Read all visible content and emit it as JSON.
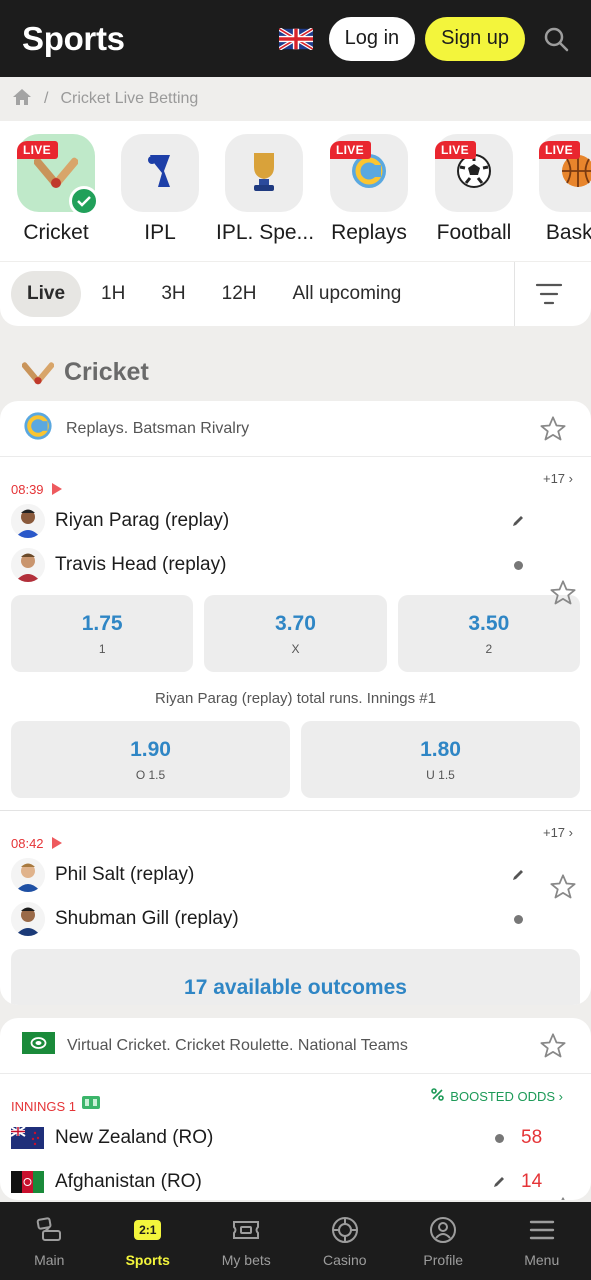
{
  "header": {
    "title": "Sports",
    "login": "Log in",
    "signup": "Sign up"
  },
  "breadcrumb": {
    "current": "Cricket Live Betting"
  },
  "categories": [
    {
      "label": "Cricket",
      "live": true,
      "active": true
    },
    {
      "label": "IPL",
      "live": false
    },
    {
      "label": "IPL. Spe...",
      "live": false
    },
    {
      "label": "Replays",
      "live": true
    },
    {
      "label": "Football",
      "live": true
    },
    {
      "label": "Basket",
      "live": true
    }
  ],
  "live_badge": "LIVE",
  "filters": [
    "Live",
    "1H",
    "3H",
    "12H",
    "All upcoming"
  ],
  "section": {
    "title": "Cricket"
  },
  "league1": {
    "name": "Replays. Batsman Rivalry",
    "match1": {
      "time": "08:39",
      "more": "+17",
      "team1": "Riyan Parag (replay)",
      "team2": "Travis Head (replay)",
      "odds": [
        {
          "v": "1.75",
          "k": "1"
        },
        {
          "v": "3.70",
          "k": "X"
        },
        {
          "v": "3.50",
          "k": "2"
        }
      ],
      "market": "Riyan Parag (replay) total runs. Innings #1",
      "totals": [
        {
          "v": "1.90",
          "k": "O 1.5"
        },
        {
          "v": "1.80",
          "k": "U 1.5"
        }
      ]
    },
    "match2": {
      "time": "08:42",
      "more": "+17",
      "team1": "Phil Salt (replay)",
      "team2": "Shubman Gill (replay)",
      "outcomes": "17 available outcomes"
    }
  },
  "league2": {
    "name": "Virtual Cricket. Cricket Roulette. National Teams",
    "match": {
      "innings": "INNINGS 1",
      "boost": "BOOSTED ODDS",
      "team1": "New Zealand (RO)",
      "score1": "58",
      "team2": "Afghanistan (RO)",
      "score2": "14"
    }
  },
  "nav": [
    {
      "label": "Main"
    },
    {
      "label": "Sports",
      "badge": "2:1"
    },
    {
      "label": "My bets"
    },
    {
      "label": "Casino"
    },
    {
      "label": "Profile"
    },
    {
      "label": "Menu"
    }
  ],
  "colors": {
    "accent": "#f3f53c",
    "live": "#e9262f",
    "odds": "#2f86c5",
    "boost": "#1d9a58"
  }
}
